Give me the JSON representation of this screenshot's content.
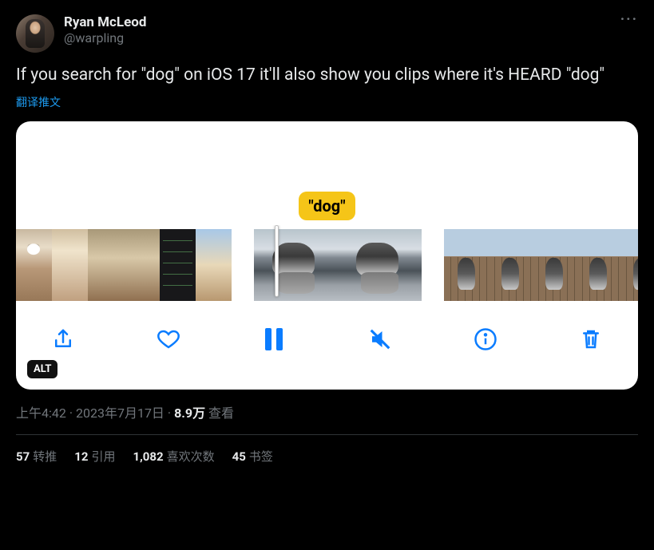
{
  "author": {
    "display_name": "Ryan McLeod",
    "handle": "@warpling"
  },
  "content": {
    "text": "If you search for \"dog\" on iOS 17 it'll also show you clips where it's HEARD \"dog\"",
    "translate_label": "翻译推文"
  },
  "media": {
    "caption_tag": "\"dog\"",
    "alt_badge": "ALT"
  },
  "meta": {
    "time": "上午4:42",
    "sep1": " · ",
    "date": "2023年7月17日",
    "sep2": " · ",
    "views_count": "8.9万",
    "views_label": " 查看"
  },
  "stats": {
    "retweets_count": "57",
    "retweets_label": "转推",
    "quotes_count": "12",
    "quotes_label": "引用",
    "likes_count": "1,082",
    "likes_label": "喜欢次数",
    "bookmarks_count": "45",
    "bookmarks_label": "书签"
  }
}
